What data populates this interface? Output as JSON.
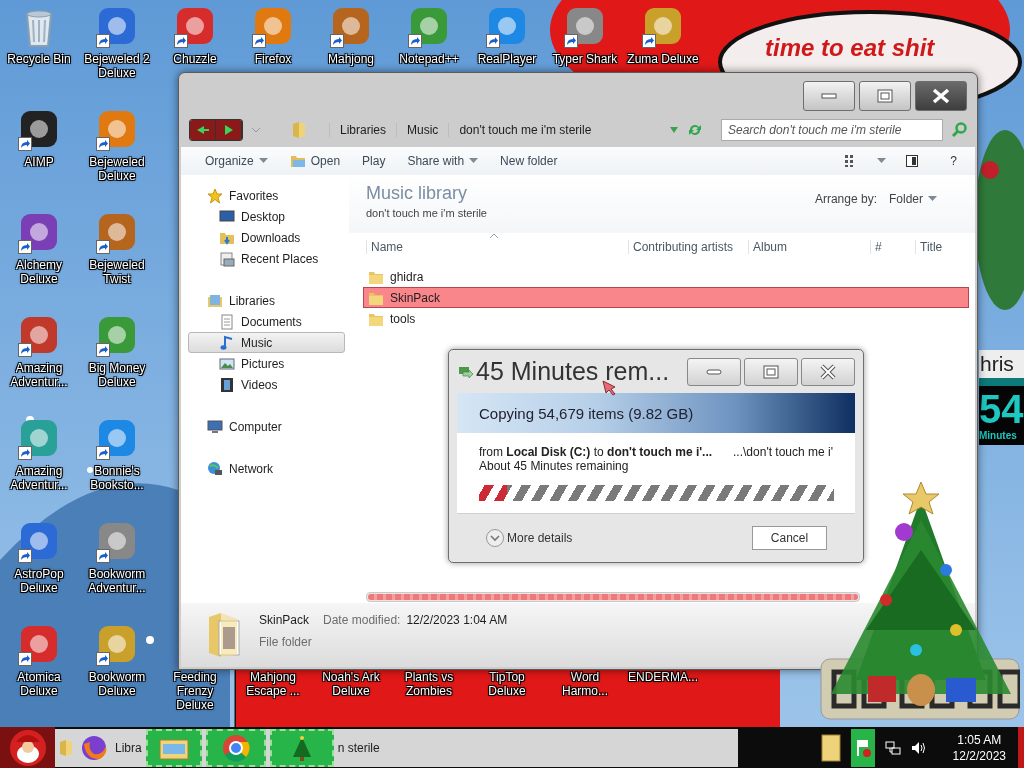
{
  "desktop": {
    "top_row": [
      {
        "label": "Recycle Bin",
        "kind": "bin"
      },
      {
        "label": "Bejeweled 2 Deluxe",
        "kind": "app"
      },
      {
        "label": "Chuzzle",
        "kind": "app"
      },
      {
        "label": "Firefox",
        "kind": "app"
      },
      {
        "label": "Mahjong",
        "kind": "app"
      },
      {
        "label": "Notepad++",
        "kind": "app"
      },
      {
        "label": "RealPlayer",
        "kind": "app"
      },
      {
        "label": "Typer Shark",
        "kind": "app"
      },
      {
        "label": "Zuma Deluxe",
        "kind": "app"
      }
    ],
    "column_1": [
      {
        "label": "AIMP"
      },
      {
        "label": "Alchemy Deluxe"
      },
      {
        "label": "Amazing Adventur..."
      },
      {
        "label": "Amazing Adventur..."
      },
      {
        "label": "AstroPop Deluxe"
      },
      {
        "label": "Atomica Deluxe"
      }
    ],
    "column_2": [
      {
        "label": "Bejeweled Deluxe"
      },
      {
        "label": "Bejeweled Twist"
      },
      {
        "label": "Big Money Deluxe"
      },
      {
        "label": "Bonnie's Booksto..."
      },
      {
        "label": "Bookworm Adventur..."
      },
      {
        "label": "Bookworm Deluxe"
      }
    ],
    "bottom_row": [
      {
        "label": "Feeding Frenzy Deluxe"
      },
      {
        "label": "Mahjong Escape ..."
      },
      {
        "label": "Noah's Ark Deluxe"
      },
      {
        "label": "Plants vs Zombies"
      },
      {
        "label": "TipTop Deluxe"
      },
      {
        "label": "Word Harmo..."
      },
      {
        "label": "ENDERMA..."
      }
    ],
    "banner_text": "time to eat shit",
    "countdown": {
      "title": "hris",
      "value": "54",
      "unit": "Minutes"
    }
  },
  "explorer": {
    "breadcrumb": [
      "Libraries",
      "Music",
      "don't touch me i'm sterile"
    ],
    "search": {
      "placeholder": "Search don't touch me i'm sterile"
    },
    "toolbar": [
      {
        "label": "Organize",
        "kind": "menu"
      },
      {
        "label": "Open",
        "kind": "icon"
      },
      {
        "label": "Play",
        "kind": "plain"
      },
      {
        "label": "Share with",
        "kind": "menu"
      },
      {
        "label": "New folder",
        "kind": "plain"
      }
    ],
    "help": "?",
    "sidebar": [
      {
        "label": "Favorites",
        "selected": false,
        "children": [
          {
            "label": "Desktop",
            "selected": false
          },
          {
            "label": "Downloads",
            "selected": false
          },
          {
            "label": "Recent Places",
            "selected": false
          }
        ]
      },
      {
        "label": "Libraries",
        "selected": false,
        "children": [
          {
            "label": "Documents",
            "selected": false
          },
          {
            "label": "Music",
            "selected": true
          },
          {
            "label": "Pictures",
            "selected": false
          },
          {
            "label": "Videos",
            "selected": false
          }
        ]
      },
      {
        "label": "Computer",
        "selected": false
      },
      {
        "label": "Network",
        "selected": false
      }
    ],
    "library": {
      "title": "Music library",
      "subtitle": "don't touch me i'm sterile",
      "arrange_label": "Arrange by:",
      "arrange_value": "Folder"
    },
    "columns": [
      "Name",
      "Contributing artists",
      "Album",
      "#",
      "Title"
    ],
    "transfer_bar": {
      "level": 1
    },
    "rows": [
      {
        "name": "ghidra",
        "selected": false
      },
      {
        "name": "SkinPack",
        "selected": true
      },
      {
        "name": "tools",
        "selected": false
      }
    ],
    "details": {
      "name": "SkinPack",
      "date_label": "Date modified:",
      "date": "12/2/2023 1:04 AM",
      "type": "File folder"
    }
  },
  "copy_dialog": {
    "title": "45 Minutes rem...",
    "heading": "Copying 54,679 items (9.82 GB)",
    "from_line": "from **Local Disk (C:)** to **don't touch me i'...**",
    "path": "...\\don't touch me i'",
    "remaining": "About 45 Minutes remaining",
    "level": 0.08,
    "more_details": "More details",
    "cancel": "Cancel"
  },
  "taskbar": {
    "task_texts": [
      "Libra",
      "n sterile"
    ],
    "time": "1:05 AM",
    "date": "12/2/2023"
  }
}
